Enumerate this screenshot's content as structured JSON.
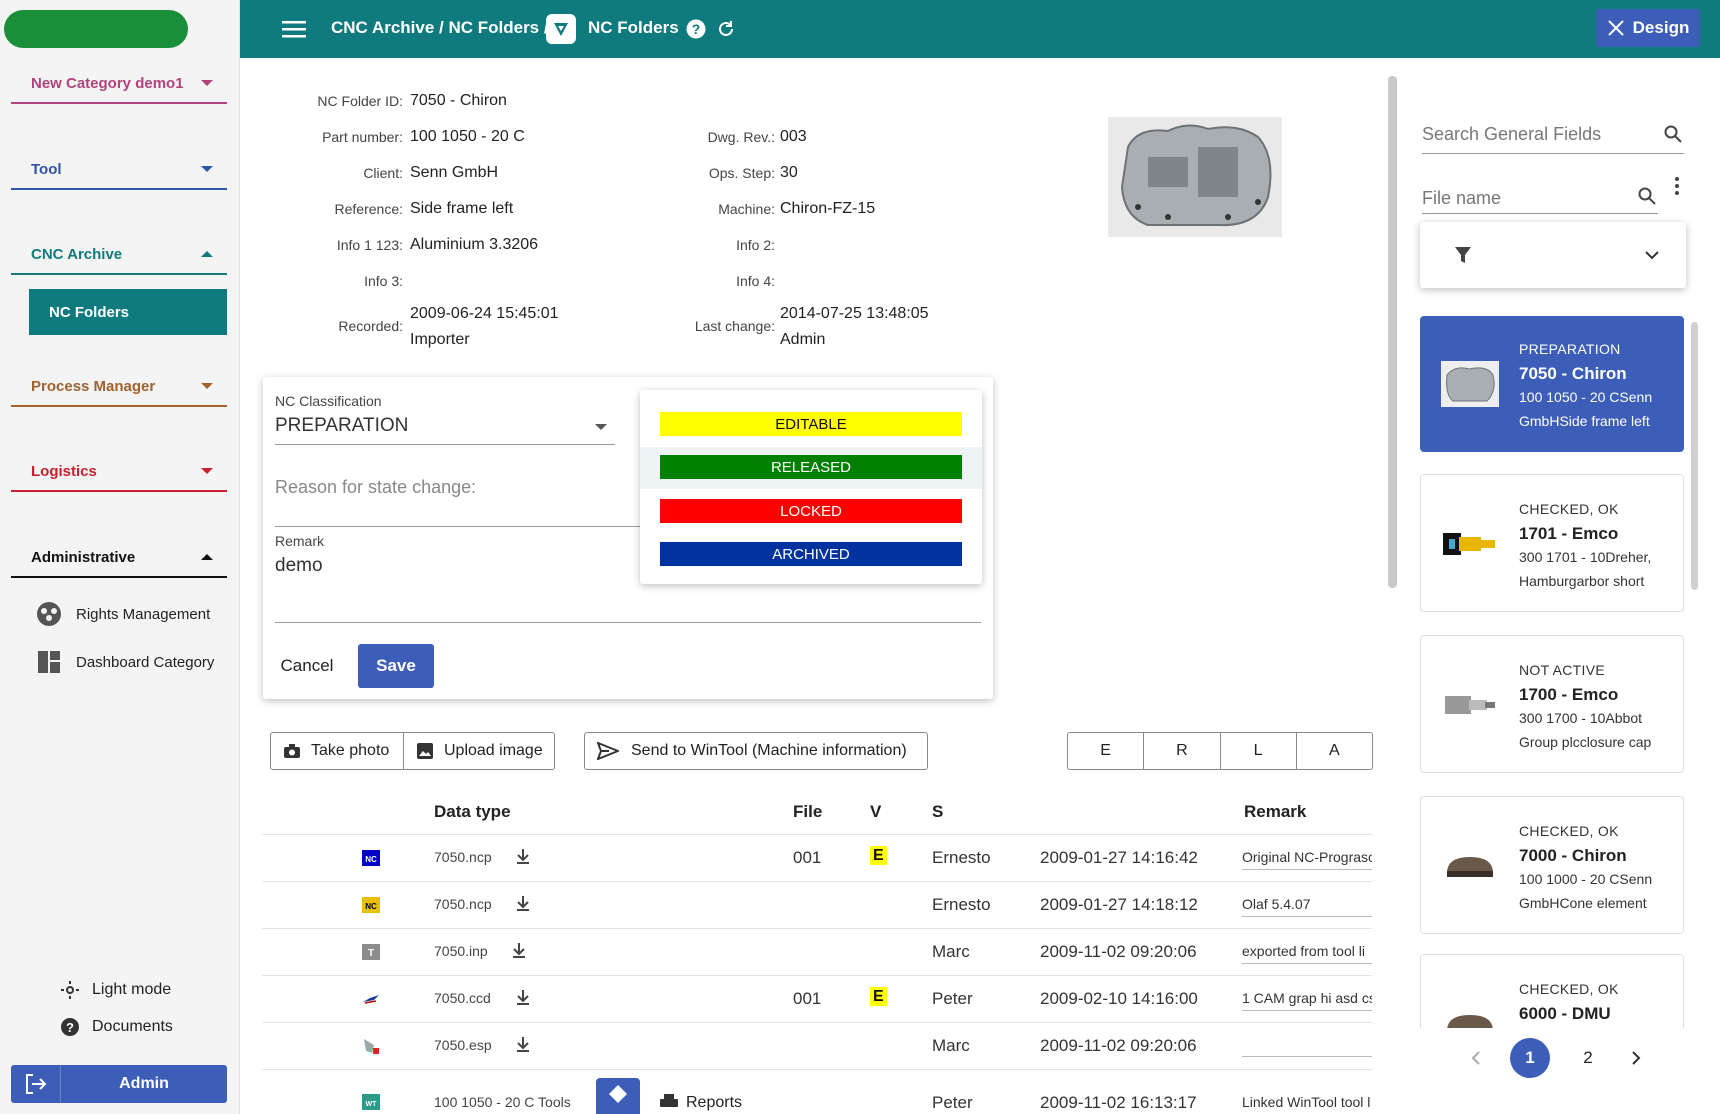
{
  "sidebar": {
    "sections": [
      {
        "label": "New Category demo1",
        "color": "#b0447e",
        "state": "collapsed"
      },
      {
        "label": "Tool",
        "color": "#2f56a6",
        "state": "collapsed"
      },
      {
        "label": "CNC Archive",
        "color": "#0f7b7e",
        "state": "expanded"
      },
      {
        "label": "Process Manager",
        "color": "#a1622e",
        "state": "collapsed"
      },
      {
        "label": "Logistics",
        "color": "#c8202e",
        "state": "collapsed"
      },
      {
        "label": "Administrative",
        "color": "#111111",
        "state": "expanded"
      }
    ],
    "active_sub": "NC Folders",
    "admin_items": [
      {
        "label": "Rights Management",
        "icon": "rights-icon"
      },
      {
        "label": "Dashboard Category",
        "icon": "dashboard-icon"
      }
    ],
    "light_mode": "Light mode",
    "documents": "Documents",
    "user": "Admin"
  },
  "topbar": {
    "breadcrumb": "CNC Archive / NC Folders /",
    "title": "NC Folders",
    "design_label": "Design",
    "bg_color": "#0f7b7e"
  },
  "details": {
    "nc_folder_id_label": "NC Folder ID:",
    "nc_folder_id": "7050 - Chiron",
    "part_number_label": "Part number:",
    "part_number": "100 1050 - 20 C",
    "client_label": "Client:",
    "client": "Senn GmbH",
    "reference_label": "Reference:",
    "reference": "Side frame left",
    "info1_label": "Info 1 123:",
    "info1": "Aluminium 3.3206",
    "info3_label": "Info 3:",
    "recorded_label": "Recorded:",
    "recorded_date": "2009-06-24 15:45:01",
    "recorded_by": "Importer",
    "dwg_rev_label": "Dwg. Rev.:",
    "dwg_rev": "003",
    "ops_step_label": "Ops. Step:",
    "ops_step": "30",
    "machine_label": "Machine:",
    "machine": "Chiron-FZ-15",
    "info2_label": "Info 2:",
    "info4_label": "Info 4:",
    "last_change_label": "Last change:",
    "last_change_date": "2014-07-25 13:48:05",
    "last_change_by": "Admin"
  },
  "classification_dialog": {
    "field_label": "NC Classification",
    "value": "PREPARATION",
    "reason_placeholder": "Reason for state change:",
    "remark_label": "Remark",
    "remark_value": "demo",
    "cancel": "Cancel",
    "save": "Save"
  },
  "state_options": [
    {
      "label": "EDITABLE",
      "bg": "#ffff00",
      "fg": "#111111"
    },
    {
      "label": "RELEASED",
      "bg": "#008000",
      "fg": "#ffffff"
    },
    {
      "label": "LOCKED",
      "bg": "#ff0000",
      "fg": "#ffffff"
    },
    {
      "label": "ARCHIVED",
      "bg": "#0033a0",
      "fg": "#ffffff"
    }
  ],
  "toolbar": {
    "take_photo": "Take photo",
    "upload_image": "Upload image",
    "send_wintool": "Send to WinTool (Machine information)",
    "filters": [
      "E",
      "R",
      "L",
      "A"
    ]
  },
  "table": {
    "headers": {
      "data_type": "Data type",
      "file": "File",
      "v": "V",
      "s": "S",
      "remark": "Remark"
    },
    "rows": [
      {
        "icon": "nc-blue-icon",
        "name": "7050.ncp",
        "file": "001",
        "v": "E",
        "user": "Ernesto",
        "date": "2009-01-27 14:16:42",
        "remark": "Original NC-Prograsc"
      },
      {
        "icon": "nc-yellow-icon",
        "name": "7050.ncp",
        "file": "",
        "v": "",
        "user": "Ernesto",
        "date": "2009-01-27 14:18:12",
        "remark": "Olaf 5.4.07"
      },
      {
        "icon": "text-file-icon",
        "name": "7050.inp",
        "file": "",
        "v": "",
        "user": "Marc",
        "date": "2009-11-02 09:20:06",
        "remark": "exported from tool li"
      },
      {
        "icon": "cam-icon",
        "name": "7050.ccd",
        "file": "001",
        "v": "E",
        "user": "Peter",
        "date": "2009-02-10 14:16:00",
        "remark": "1 CAM grap hi asd cs"
      },
      {
        "icon": "esp-icon",
        "name": "7050.esp",
        "file": "",
        "v": "",
        "user": "Marc",
        "date": "2009-11-02 09:20:06",
        "remark": ""
      },
      {
        "icon": "wintool-icon",
        "name": "100 1050 - 20 C Tools",
        "file": "",
        "v": "",
        "user": "Peter",
        "date": "2009-11-02 16:13:17",
        "remark": "Linked WinTool tool l",
        "reports": "Reports"
      }
    ]
  },
  "right_panel": {
    "search_placeholder": "Search General Fields",
    "filename_placeholder": "File name",
    "cards": [
      {
        "status": "PREPARATION",
        "title": "7050 - Chiron",
        "line1": "100 1050 - 20 CSenn",
        "line2": "GmbHSide frame left",
        "active": true
      },
      {
        "status": "CHECKED, OK",
        "title": "1701 - Emco",
        "line1": "300 1701 - 10Dreher,",
        "line2": "Hamburgarbor short",
        "active": false
      },
      {
        "status": "NOT ACTIVE",
        "title": "1700 - Emco",
        "line1": "300 1700 - 10Abbot",
        "line2": "Group plcclosure cap",
        "active": false
      },
      {
        "status": "CHECKED, OK",
        "title": "7000 - Chiron",
        "line1": "100 1000 - 20 CSenn",
        "line2": "GmbHCone element",
        "active": false
      },
      {
        "status": "CHECKED, OK",
        "title": "6000 - DMU",
        "line1": "",
        "line2": "",
        "active": false
      }
    ],
    "pages": [
      "1",
      "2"
    ],
    "current_page": "1"
  }
}
